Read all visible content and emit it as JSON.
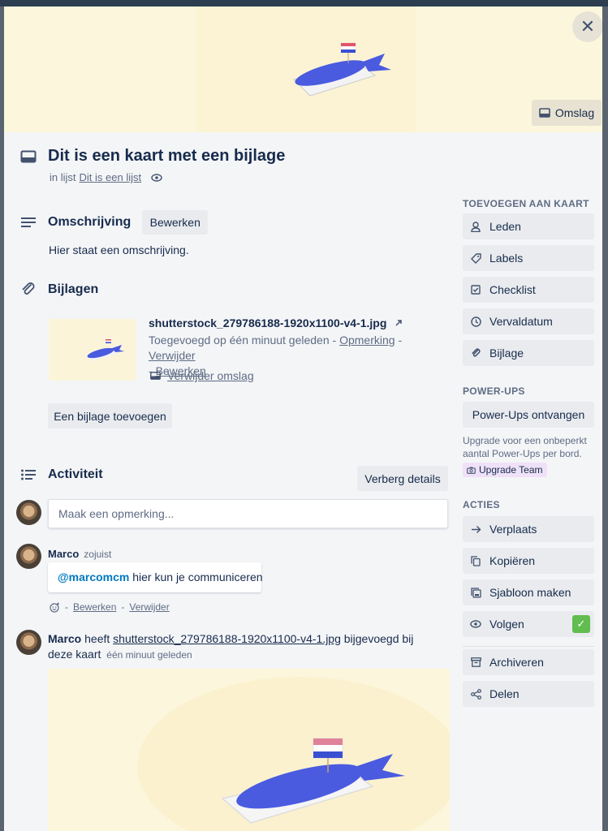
{
  "header": {
    "close_label": "✕",
    "cover_button": "Omslag"
  },
  "card": {
    "title": "Dit is een kaart met een bijlage",
    "in_list_prefix": "in lijst",
    "list_name": "Dit is een lijst"
  },
  "description": {
    "heading": "Omschrijving",
    "edit_button": "Bewerken",
    "text": "Hier staat een omschrijving."
  },
  "attachments": {
    "heading": "Bijlagen",
    "file_name": "shutterstock_279786188-1920x1100-v4-1.jpg",
    "added_text": "Toegevoegd op één minuut geleden",
    "sep": "-",
    "comment_link": "Opmerking",
    "delete_link": "Verwijder",
    "edit_link": "Bewerken",
    "remove_cover": "Verwijder omslag",
    "add_button": "Een bijlage toevoegen"
  },
  "activity": {
    "heading": "Activiteit",
    "hide_details": "Verberg details",
    "comment_placeholder": "Maak een opmerking...",
    "entries": [
      {
        "author": "Marco",
        "time": "zojuist",
        "mention": "@marcomcm",
        "text": "hier kun je communiceren",
        "edit": "Bewerken",
        "delete": "Verwijder"
      },
      {
        "author": "Marco",
        "verb": "heeft",
        "file": "shutterstock_279786188-1920x1100-v4-1.jpg",
        "suffix": "bijgevoegd bij deze kaart",
        "time": "één minuut geleden"
      }
    ]
  },
  "sidebar": {
    "add_heading": "TOEVOEGEN AAN KAART",
    "add_items": [
      {
        "label": "Leden",
        "icon": "person-icon"
      },
      {
        "label": "Labels",
        "icon": "tag-icon"
      },
      {
        "label": "Checklist",
        "icon": "checklist-icon"
      },
      {
        "label": "Vervaldatum",
        "icon": "clock-icon"
      },
      {
        "label": "Bijlage",
        "icon": "paperclip-icon"
      }
    ],
    "powerups_heading": "POWER-UPS",
    "powerups_button": "Power-Ups ontvangen",
    "upgrade_text": "Upgrade voor een onbeperkt aantal Power-Ups per bord.",
    "upgrade_badge": "Upgrade Team",
    "actions_heading": "ACTIES",
    "actions": [
      {
        "label": "Verplaats",
        "icon": "arrow-right-icon"
      },
      {
        "label": "Kopiëren",
        "icon": "copy-icon"
      },
      {
        "label": "Sjabloon maken",
        "icon": "template-icon"
      },
      {
        "label": "Volgen",
        "icon": "eye-icon"
      },
      {
        "label": "Archiveren",
        "icon": "archive-icon"
      },
      {
        "label": "Delen",
        "icon": "share-icon"
      }
    ],
    "follow_checked": "✓"
  }
}
